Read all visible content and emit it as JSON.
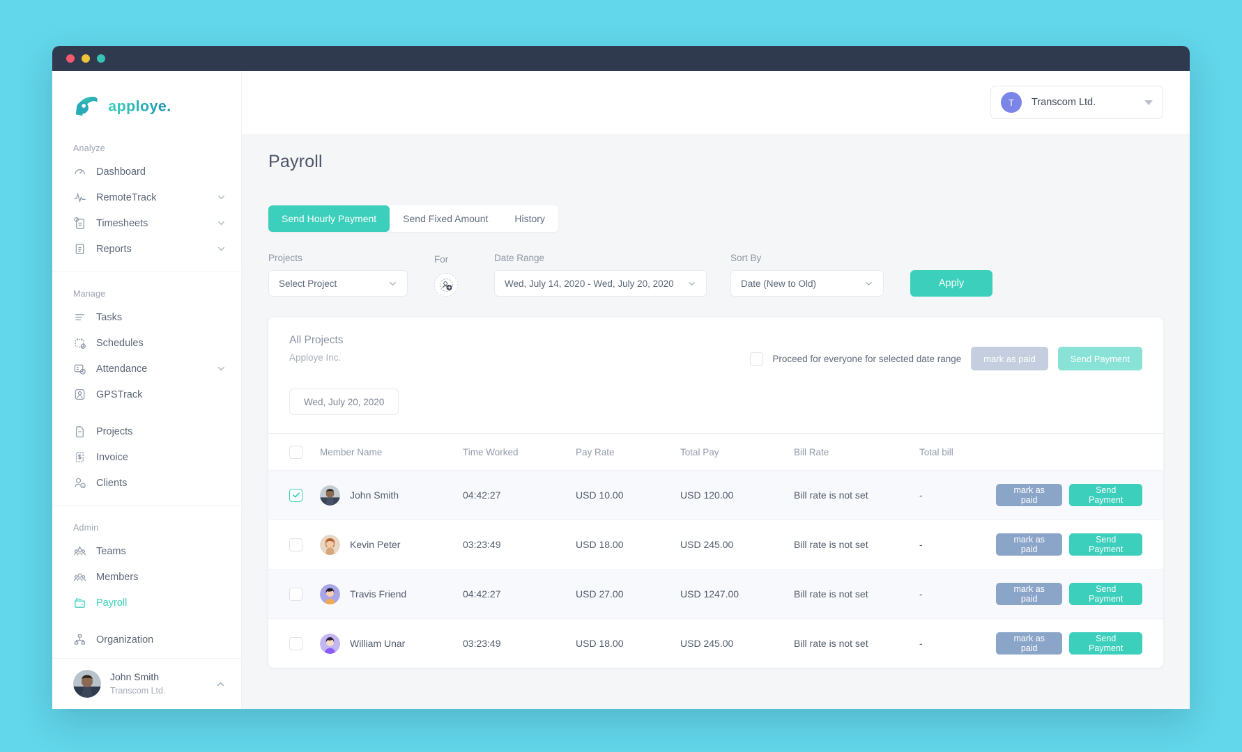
{
  "brand": {
    "name": "apploye",
    "accent": "#3ccfbb",
    "accent_dark": "#1fa79c",
    "titlebar": "#2f3a4f",
    "page_bg": "#62d6ea"
  },
  "window": {
    "traffic_lights": [
      "close-red",
      "minimize-yellow",
      "maximize-green"
    ]
  },
  "topbar": {
    "org": {
      "initial": "T",
      "name": "Transcom Ltd.",
      "caret_icon": "chevron-down-icon"
    }
  },
  "sidebar": {
    "groups": [
      {
        "label": "Analyze",
        "items": [
          {
            "label": "Dashboard",
            "icon": "gauge-icon",
            "expandable": false,
            "active": false
          },
          {
            "label": "RemoteTrack",
            "icon": "pulse-icon",
            "expandable": true,
            "active": false
          },
          {
            "label": "Timesheets",
            "icon": "timesheet-icon",
            "expandable": true,
            "active": false
          },
          {
            "label": "Reports",
            "icon": "document-icon",
            "expandable": true,
            "active": false
          }
        ]
      },
      {
        "label": "Manage",
        "items": [
          {
            "label": "Tasks",
            "icon": "list-icon",
            "expandable": false,
            "active": false
          },
          {
            "label": "Schedules",
            "icon": "calendar-check-icon",
            "expandable": false,
            "active": false
          },
          {
            "label": "Attendance",
            "icon": "attendance-icon",
            "expandable": true,
            "active": false
          },
          {
            "label": "GPSTrack",
            "icon": "map-pin-user-icon",
            "expandable": false,
            "active": false
          },
          {
            "label": "",
            "icon": "spacer",
            "expandable": false,
            "active": false
          },
          {
            "label": "Projects",
            "icon": "file-minus-icon",
            "expandable": false,
            "active": false
          },
          {
            "label": "Invoice",
            "icon": "invoice-icon",
            "expandable": false,
            "active": false
          },
          {
            "label": "Clients",
            "icon": "user-info-icon",
            "expandable": false,
            "active": false
          }
        ]
      },
      {
        "label": "Admin",
        "items": [
          {
            "label": "Teams",
            "icon": "team-star-icon",
            "expandable": false,
            "active": false
          },
          {
            "label": "Members",
            "icon": "members-icon",
            "expandable": false,
            "active": false
          },
          {
            "label": "Payroll",
            "icon": "wallet-icon",
            "expandable": false,
            "active": true
          },
          {
            "label": "",
            "icon": "spacer",
            "expandable": false,
            "active": false
          },
          {
            "label": "Organization",
            "icon": "org-chart-icon",
            "expandable": false,
            "active": false
          }
        ]
      }
    ],
    "profile": {
      "name": "John Smith",
      "company": "Transcom Ltd.",
      "chevron_icon": "chevron-up-icon"
    }
  },
  "page": {
    "title": "Payroll",
    "tabs": [
      {
        "label": "Send Hourly Payment",
        "active": true
      },
      {
        "label": "Send Fixed Amount",
        "active": false
      },
      {
        "label": "History",
        "active": false
      }
    ],
    "filters": {
      "projects": {
        "label": "Projects",
        "value": "Select Project"
      },
      "for": {
        "label": "For",
        "icon": "add-member-icon"
      },
      "date_range": {
        "label": "Date Range",
        "value": "Wed, July 14, 2020 - Wed, July 20, 2020"
      },
      "sort_by": {
        "label": "Sort By",
        "value": "Date (New to Old)"
      },
      "apply": {
        "label": "Apply"
      }
    },
    "card": {
      "title": "All Projects",
      "subtitle": "Apploye Inc.",
      "proceed_label": "Proceed for everyone for selected date range",
      "proceed_checked": false,
      "bulk_mark_label": "mark as paid",
      "bulk_send_label": "Send Payment",
      "date_chip": "Wed, July 20, 2020",
      "table": {
        "columns": [
          "Member Name",
          "Time Worked",
          "Pay Rate",
          "Total Pay",
          "Bill Rate",
          "Total bill"
        ],
        "header_checkbox_checked": false,
        "row_actions": {
          "mark_label": "mark as paid",
          "send_label": "Send Payment"
        },
        "rows": [
          {
            "checked": true,
            "name": "John Smith",
            "avatar_bg": "#5f6d7e",
            "time_worked": "04:42:27",
            "pay_rate": "USD 10.00",
            "total_pay": "USD 120.00",
            "bill_rate": "Bill rate is not set",
            "total_bill": "-"
          },
          {
            "checked": false,
            "name": "Kevin Peter",
            "avatar_bg": "#d68f6a",
            "time_worked": "03:23:49",
            "pay_rate": "USD 18.00",
            "total_pay": "USD 245.00",
            "bill_rate": "Bill rate is not set",
            "total_bill": "-"
          },
          {
            "checked": false,
            "name": "Travis Friend",
            "avatar_bg": "#f0a868",
            "time_worked": "04:42:27",
            "pay_rate": "USD 27.00",
            "total_pay": "USD 1247.00",
            "bill_rate": "Bill rate is not set",
            "total_bill": "-"
          },
          {
            "checked": false,
            "name": "William Unar",
            "avatar_bg": "#9b6bdd",
            "time_worked": "03:23:49",
            "pay_rate": "USD 18.00",
            "total_pay": "USD 245.00",
            "bill_rate": "Bill rate is not set",
            "total_bill": "-"
          }
        ]
      }
    }
  }
}
